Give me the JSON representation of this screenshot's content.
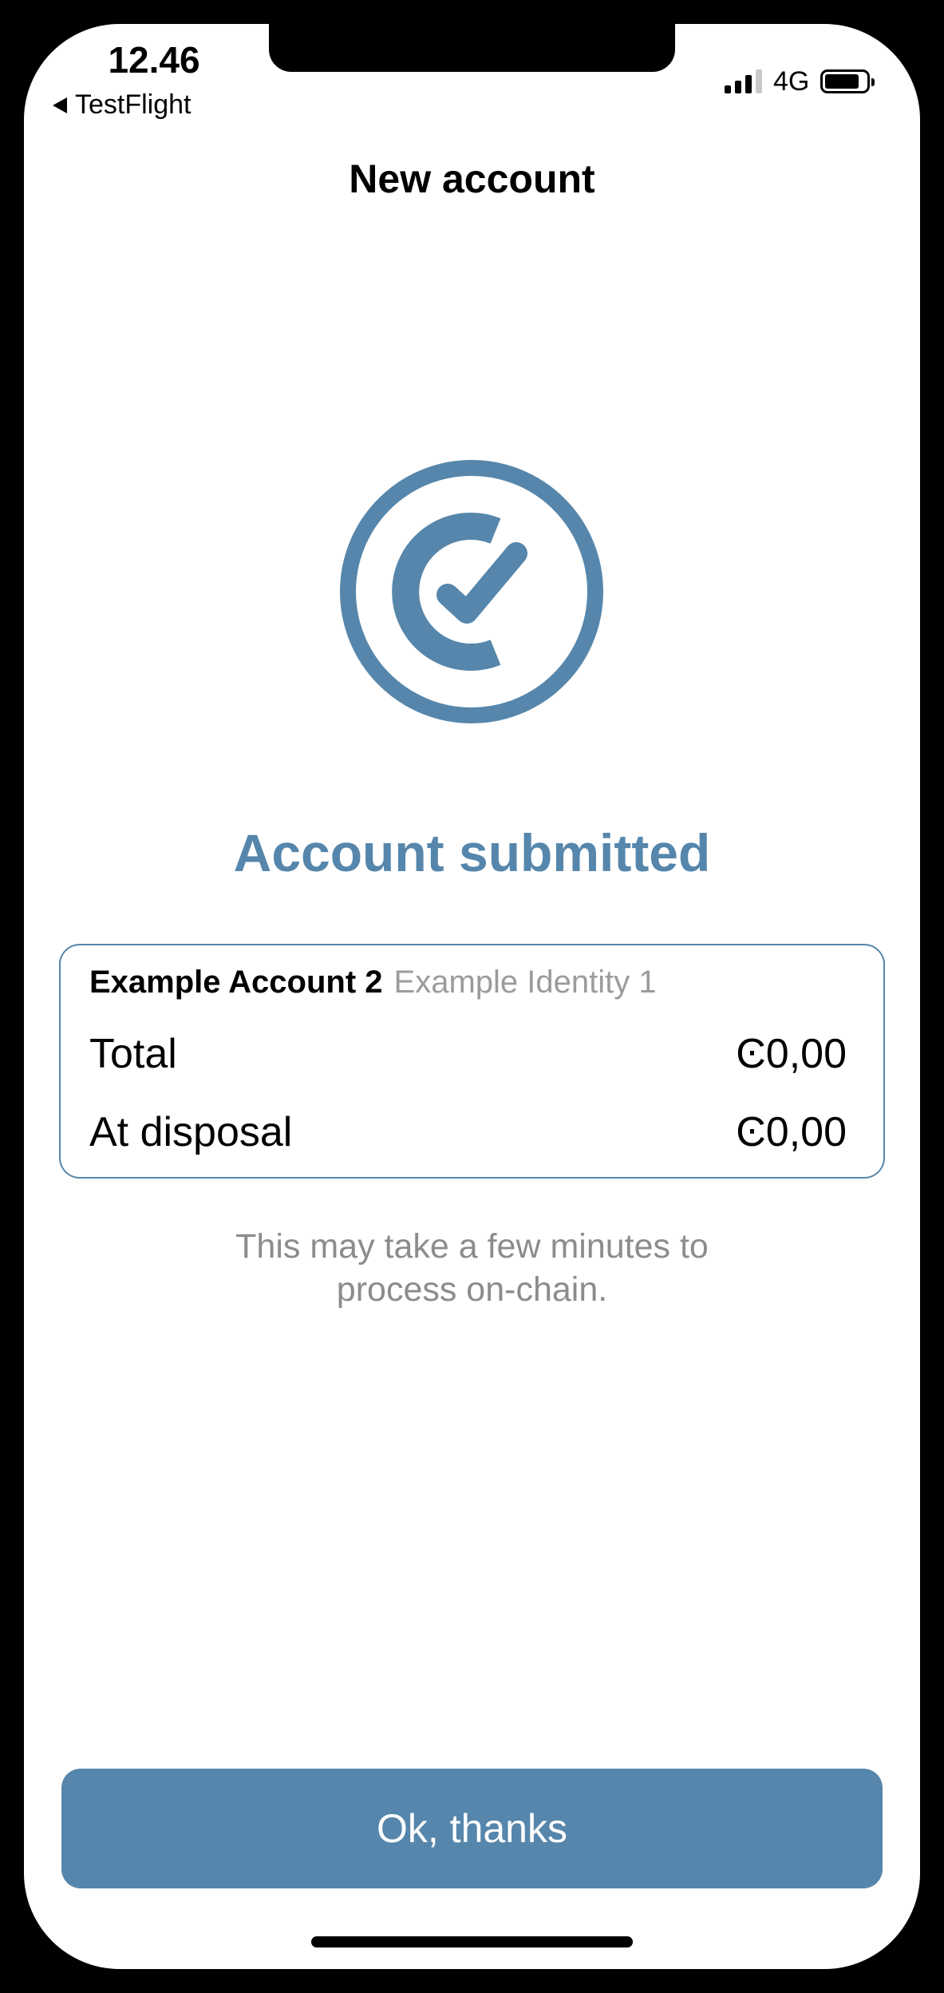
{
  "status_bar": {
    "time": "12.46",
    "back_app": "TestFlight",
    "network": "4G",
    "icons": [
      "signal-bars-icon",
      "battery-icon",
      "back-triangle-icon"
    ]
  },
  "nav": {
    "title": "New account"
  },
  "result": {
    "icon": "concordium-check-icon",
    "heading": "Account submitted"
  },
  "account_card": {
    "account_name": "Example Account 2",
    "identity_name": "Example Identity 1",
    "rows": [
      {
        "label": "Total",
        "value": "Ͼ0,00"
      },
      {
        "label": "At disposal",
        "value": "Ͼ0,00"
      }
    ]
  },
  "note": {
    "text": "This may take a few minutes to process on-chain."
  },
  "actions": {
    "ok_label": "Ok, thanks"
  },
  "colors": {
    "accent": "#5686ab",
    "muted_text": "#8c8c8c",
    "background": "#ffffff"
  }
}
